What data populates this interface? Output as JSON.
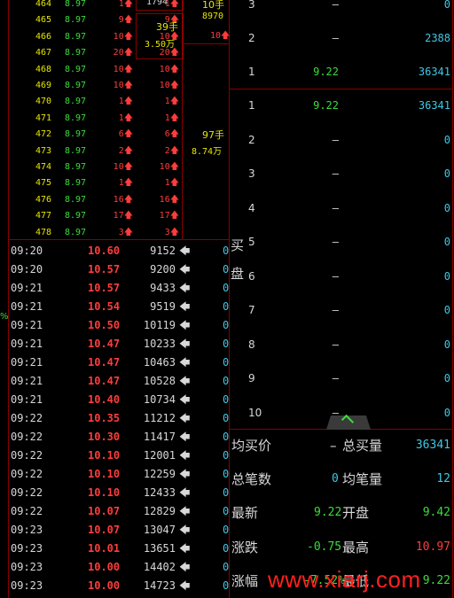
{
  "ticks": [
    {
      "id": "464",
      "price": "8.97",
      "vol": "1",
      "vol2": "1"
    },
    {
      "id": "465",
      "price": "8.97",
      "vol": "9",
      "vol2": "9"
    },
    {
      "id": "466",
      "price": "8.97",
      "vol": "10",
      "vol2": "10"
    },
    {
      "id": "467",
      "price": "8.97",
      "vol": "20",
      "vol2": "20"
    },
    {
      "id": "468",
      "price": "8.97",
      "vol": "10",
      "vol2": "10"
    },
    {
      "id": "469",
      "price": "8.97",
      "vol": "10",
      "vol2": "10"
    },
    {
      "id": "470",
      "price": "8.97",
      "vol": "1",
      "vol2": "1"
    },
    {
      "id": "471",
      "price": "8.97",
      "vol": "1",
      "vol2": "1"
    },
    {
      "id": "472",
      "price": "8.97",
      "vol": "6",
      "vol2": "6"
    },
    {
      "id": "473",
      "price": "8.97",
      "vol": "2",
      "vol2": "2"
    },
    {
      "id": "474",
      "price": "8.97",
      "vol": "10",
      "vol2": "10"
    },
    {
      "id": "475",
      "price": "8.97",
      "vol": "1",
      "vol2": "1"
    },
    {
      "id": "476",
      "price": "8.97",
      "vol": "16",
      "vol2": "16"
    },
    {
      "id": "477",
      "price": "8.97",
      "vol": "17",
      "vol2": "17"
    },
    {
      "id": "478",
      "price": "8.97",
      "vol": "3",
      "vol2": "3"
    }
  ],
  "summary_boxes": {
    "top_value": "1794",
    "top_right_label": "10手",
    "top_right_value": "8970",
    "box1_hand": "39手",
    "box1_amount": "3.50万",
    "box1_right": "10",
    "box2_hand": "97手",
    "box2_amount": "8.74万"
  },
  "trades": [
    {
      "time": "09:20",
      "price": "10.60",
      "vol": "9152",
      "flag": "0"
    },
    {
      "time": "09:20",
      "price": "10.57",
      "vol": "9200",
      "flag": "0"
    },
    {
      "time": "09:21",
      "price": "10.57",
      "vol": "9433",
      "flag": "0"
    },
    {
      "time": "09:21",
      "price": "10.54",
      "vol": "9519",
      "flag": "0"
    },
    {
      "time": "09:21",
      "price": "10.50",
      "vol": "10119",
      "flag": "0"
    },
    {
      "time": "09:21",
      "price": "10.47",
      "vol": "10233",
      "flag": "0"
    },
    {
      "time": "09:21",
      "price": "10.47",
      "vol": "10463",
      "flag": "0"
    },
    {
      "time": "09:21",
      "price": "10.47",
      "vol": "10528",
      "flag": "0"
    },
    {
      "time": "09:21",
      "price": "10.40",
      "vol": "10734",
      "flag": "0"
    },
    {
      "time": "09:22",
      "price": "10.35",
      "vol": "11212",
      "flag": "0"
    },
    {
      "time": "09:22",
      "price": "10.30",
      "vol": "11417",
      "flag": "0"
    },
    {
      "time": "09:22",
      "price": "10.10",
      "vol": "12001",
      "flag": "0"
    },
    {
      "time": "09:22",
      "price": "10.10",
      "vol": "12259",
      "flag": "0"
    },
    {
      "time": "09:22",
      "price": "10.10",
      "vol": "12433",
      "flag": "0"
    },
    {
      "time": "09:22",
      "price": "10.07",
      "vol": "12829",
      "flag": "0"
    },
    {
      "time": "09:23",
      "price": "10.07",
      "vol": "13047",
      "flag": "0"
    },
    {
      "time": "09:23",
      "price": "10.01",
      "vol": "13651",
      "flag": "0"
    },
    {
      "time": "09:23",
      "price": "10.00",
      "vol": "14402",
      "flag": "0"
    },
    {
      "time": "09:23",
      "price": "10.00",
      "vol": "14723",
      "flag": "0"
    }
  ],
  "sell_side": [
    {
      "level": "3",
      "price": "–",
      "qty": "0"
    },
    {
      "level": "2",
      "price": "–",
      "qty": "2388"
    },
    {
      "level": "1",
      "price": "9.22",
      "qty": "36341"
    }
  ],
  "buy_side": {
    "label_top": "买",
    "label_bottom": "盘",
    "levels": [
      {
        "level": "1",
        "price": "9.22",
        "qty": "36341"
      },
      {
        "level": "2",
        "price": "–",
        "qty": "0"
      },
      {
        "level": "3",
        "price": "–",
        "qty": "0"
      },
      {
        "level": "4",
        "price": "–",
        "qty": "0"
      },
      {
        "level": "5",
        "price": "–",
        "qty": "0"
      },
      {
        "level": "6",
        "price": "–",
        "qty": "0"
      },
      {
        "level": "7",
        "price": "–",
        "qty": "0"
      },
      {
        "level": "8",
        "price": "–",
        "qty": "0"
      },
      {
        "level": "9",
        "price": "–",
        "qty": "0"
      },
      {
        "level": "10",
        "price": "–",
        "qty": "0"
      }
    ]
  },
  "left_edge_mark": "%",
  "stats": {
    "avg_buy_label": "均买价",
    "avg_buy_value": "–",
    "total_buy_label": "总买量",
    "total_buy_value": "36341",
    "total_trades_label": "总笔数",
    "total_trades_value": "0",
    "avg_trade_label": "均笔量",
    "avg_trade_value": "12",
    "latest_label": "最新",
    "latest_value": "9.22",
    "open_label": "开盘",
    "open_value": "9.42",
    "change_label": "涨跌",
    "change_value": "-0.75",
    "high_label": "最高",
    "high_value": "10.97",
    "pct_label": "涨幅",
    "pct_value": "-7.52%",
    "low_label": "最低",
    "low_value": "9.22"
  },
  "watermark": "www.xiarj.com",
  "colors": {
    "up": "#ff3c3c",
    "down": "#3cdc3c",
    "volume": "#3cc8e6",
    "grid": "#8a0000"
  }
}
